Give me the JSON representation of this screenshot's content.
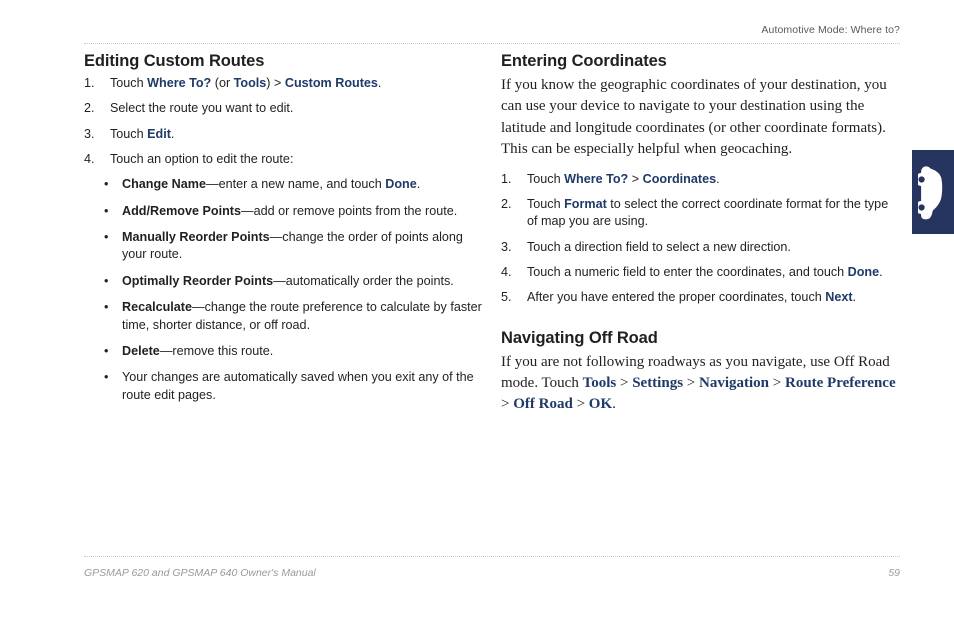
{
  "header": {
    "running_head": "Automotive Mode: Where to?"
  },
  "left_column": {
    "heading": "Editing Custom Routes",
    "steps": [
      {
        "num": "1.",
        "parts": [
          {
            "t": "Touch ",
            "s": "plain"
          },
          {
            "t": "Where To?",
            "s": "ui"
          },
          {
            "t": " (or ",
            "s": "plain"
          },
          {
            "t": "Tools",
            "s": "ui"
          },
          {
            "t": ") > ",
            "s": "plain"
          },
          {
            "t": "Custom Routes",
            "s": "ui"
          },
          {
            "t": ".",
            "s": "plain"
          }
        ]
      },
      {
        "num": "2.",
        "parts": [
          {
            "t": "Select the route you want to edit.",
            "s": "plain"
          }
        ]
      },
      {
        "num": "3.",
        "parts": [
          {
            "t": "Touch ",
            "s": "plain"
          },
          {
            "t": "Edit",
            "s": "ui"
          },
          {
            "t": ".",
            "s": "plain"
          }
        ]
      },
      {
        "num": "4.",
        "parts": [
          {
            "t": "Touch an option to edit the route:",
            "s": "plain"
          }
        ]
      }
    ],
    "bullets": [
      {
        "marker": "•",
        "parts": [
          {
            "t": "Change Name",
            "s": "term"
          },
          {
            "t": "—enter a new name, and touch ",
            "s": "plain"
          },
          {
            "t": "Done",
            "s": "ui"
          },
          {
            "t": ".",
            "s": "plain"
          }
        ]
      },
      {
        "marker": "•",
        "parts": [
          {
            "t": "Add/Remove Points",
            "s": "term"
          },
          {
            "t": "—add or remove points from the route.",
            "s": "plain"
          }
        ]
      },
      {
        "marker": "•",
        "parts": [
          {
            "t": "Manually Reorder Points",
            "s": "term"
          },
          {
            "t": "—change the order of points along your route.",
            "s": "plain"
          }
        ]
      },
      {
        "marker": "•",
        "parts": [
          {
            "t": "Optimally Reorder Points",
            "s": "term"
          },
          {
            "t": "—automatically order the points.",
            "s": "plain"
          }
        ]
      },
      {
        "marker": "•",
        "parts": [
          {
            "t": "Recalculate",
            "s": "term"
          },
          {
            "t": "—change the route preference to calculate by faster time, shorter distance, or off road.",
            "s": "plain"
          }
        ]
      },
      {
        "marker": "•",
        "parts": [
          {
            "t": "Delete",
            "s": "term"
          },
          {
            "t": "—remove this route.",
            "s": "plain"
          }
        ]
      },
      {
        "marker": "•",
        "parts": [
          {
            "t": "Your changes are automatically saved when you exit any of the route edit pages.",
            "s": "plain"
          }
        ]
      }
    ]
  },
  "right_column": {
    "heading_1": "Entering Coordinates",
    "paragraph_1": "If you know the geographic coordinates of your destination, you can use your device to navigate to your destination using the latitude and longitude coordinates (or other coordinate formats). This can be especially helpful when geocaching.",
    "steps": [
      {
        "num": "1.",
        "parts": [
          {
            "t": "Touch ",
            "s": "plain"
          },
          {
            "t": "Where To?",
            "s": "ui"
          },
          {
            "t": " > ",
            "s": "plain"
          },
          {
            "t": "Coordinates",
            "s": "ui"
          },
          {
            "t": ".",
            "s": "plain"
          }
        ]
      },
      {
        "num": "2.",
        "parts": [
          {
            "t": "Touch ",
            "s": "plain"
          },
          {
            "t": "Format",
            "s": "ui"
          },
          {
            "t": " to select the correct coordinate format for the type of map you are using.",
            "s": "plain"
          }
        ]
      },
      {
        "num": "3.",
        "parts": [
          {
            "t": "Touch a direction field to select a new direction.",
            "s": "plain"
          }
        ]
      },
      {
        "num": "4.",
        "parts": [
          {
            "t": "Touch a numeric field to enter the coordinates, and touch ",
            "s": "plain"
          },
          {
            "t": "Done",
            "s": "ui"
          },
          {
            "t": ".",
            "s": "plain"
          }
        ]
      },
      {
        "num": "5.",
        "parts": [
          {
            "t": "After you have entered the proper coordinates, touch ",
            "s": "plain"
          },
          {
            "t": "Next",
            "s": "ui"
          },
          {
            "t": ".",
            "s": "plain"
          }
        ]
      }
    ],
    "heading_2": "Navigating Off Road",
    "paragraph_2_parts": [
      {
        "t": "If you are not following roadways as you navigate, use Off Road mode. Touch ",
        "s": "plain"
      },
      {
        "t": "Tools",
        "s": "ui-serif"
      },
      {
        "t": " > ",
        "s": "plain"
      },
      {
        "t": "Settings",
        "s": "ui-serif"
      },
      {
        "t": " > ",
        "s": "plain"
      },
      {
        "t": "Navigation",
        "s": "ui-serif"
      },
      {
        "t": " > ",
        "s": "plain"
      },
      {
        "t": "Route Preference",
        "s": "ui-serif"
      },
      {
        "t": " > ",
        "s": "plain"
      },
      {
        "t": "Off Road",
        "s": "ui-serif"
      },
      {
        "t": " > ",
        "s": "plain"
      },
      {
        "t": "OK",
        "s": "ui-serif"
      },
      {
        "t": ".",
        "s": "plain"
      }
    ]
  },
  "side_tab": {
    "icon": "car-icon",
    "color": "#26355f"
  },
  "footer": {
    "manual_title": "GPSMAP 620 and GPSMAP 640 Owner's Manual",
    "page_number": "59"
  }
}
